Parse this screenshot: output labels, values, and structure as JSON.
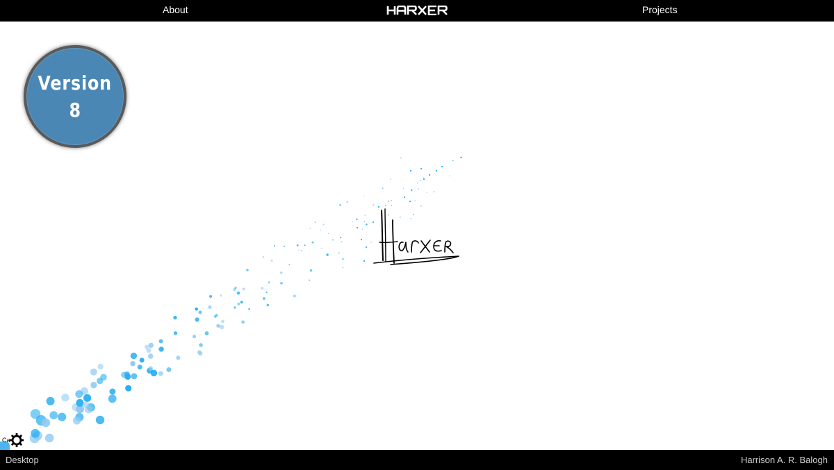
{
  "nav": {
    "about_label": "About",
    "logo_text": "HARXER",
    "projects_label": "Projects"
  },
  "badge": {
    "label": "Version",
    "number": "8"
  },
  "signature": {
    "text": "Harxer"
  },
  "corner": {
    "label": "Ca"
  },
  "footer": {
    "mode_label": "Desktop",
    "author_name": "Harrison A. R. Balogh"
  },
  "colors": {
    "bar": "#000000",
    "badge_fill": "#4a87b5",
    "badge_border": "#5a5a5a",
    "particle": "#29aef0",
    "particle_light": "#8fcaf3"
  }
}
